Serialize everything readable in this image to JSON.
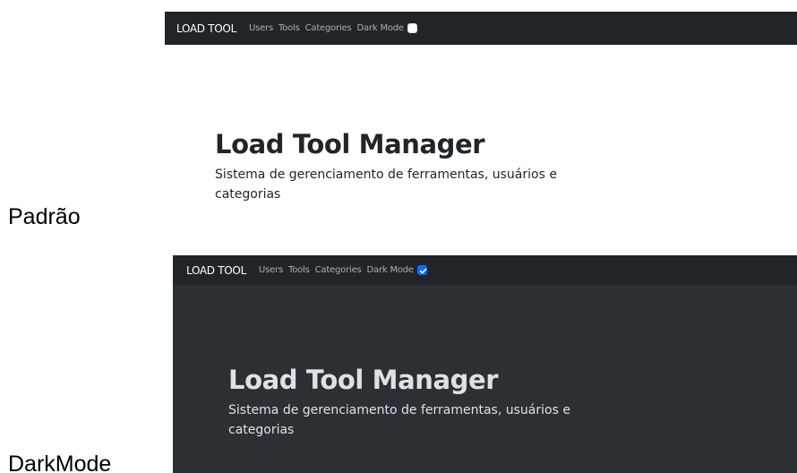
{
  "captions": {
    "light": "Padrão",
    "dark": "DarkMode"
  },
  "light": {
    "navbar": {
      "brand": "LOAD TOOL",
      "links": [
        "Users",
        "Tools",
        "Categories"
      ],
      "dark_mode_label": "Dark Mode",
      "dark_mode_checked": false
    },
    "hero": {
      "title": "Load Tool Manager",
      "text": "Sistema de gerenciamento de ferramentas, usuários e categorias"
    }
  },
  "dark": {
    "navbar": {
      "brand": "LOAD TOOL",
      "links": [
        "Users",
        "Tools",
        "Categories"
      ],
      "dark_mode_label": "Dark Mode",
      "dark_mode_checked": true
    },
    "hero": {
      "title": "Load Tool Manager",
      "text": "Sistema de gerenciamento de ferramentas, usuários e categorias"
    }
  },
  "colors": {
    "navbar_bg": "#212529",
    "dark_body_bg": "#2b3035",
    "checkbox_checked": "#0d6efd"
  }
}
